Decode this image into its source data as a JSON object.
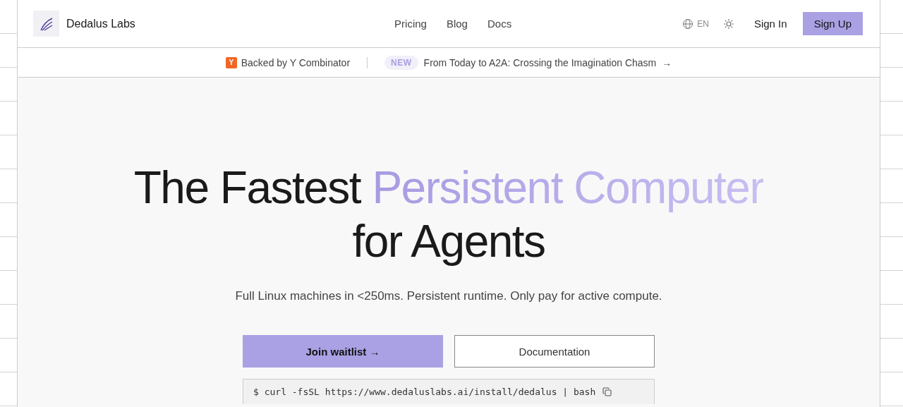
{
  "header": {
    "brand": "Dedalus Labs",
    "nav": [
      "Pricing",
      "Blog",
      "Docs"
    ],
    "language": "EN",
    "sign_in": "Sign In",
    "sign_up": "Sign Up"
  },
  "banner": {
    "badge": "Y",
    "backed": "Backed by Y Combinator",
    "tag": "NEW",
    "announcement": "From Today to A2A: Crossing the Imagination Chasm",
    "arrow": "→"
  },
  "hero": {
    "title_line_1": [
      {
        "text": "The Fastest ",
        "kind": "plain"
      },
      {
        "text": "Persistent Computer",
        "kind": "accent"
      }
    ],
    "title_line_2": "for Agents",
    "subtitle": "Full Linux machines in <250ms. Persistent runtime. Only pay for active compute.",
    "primary_button": "Join waitlist",
    "primary_arrow": "→",
    "secondary_button": "Documentation",
    "command": "$ curl -fsSL https://www.dedaluslabs.ai/install/dedalus | bash"
  }
}
